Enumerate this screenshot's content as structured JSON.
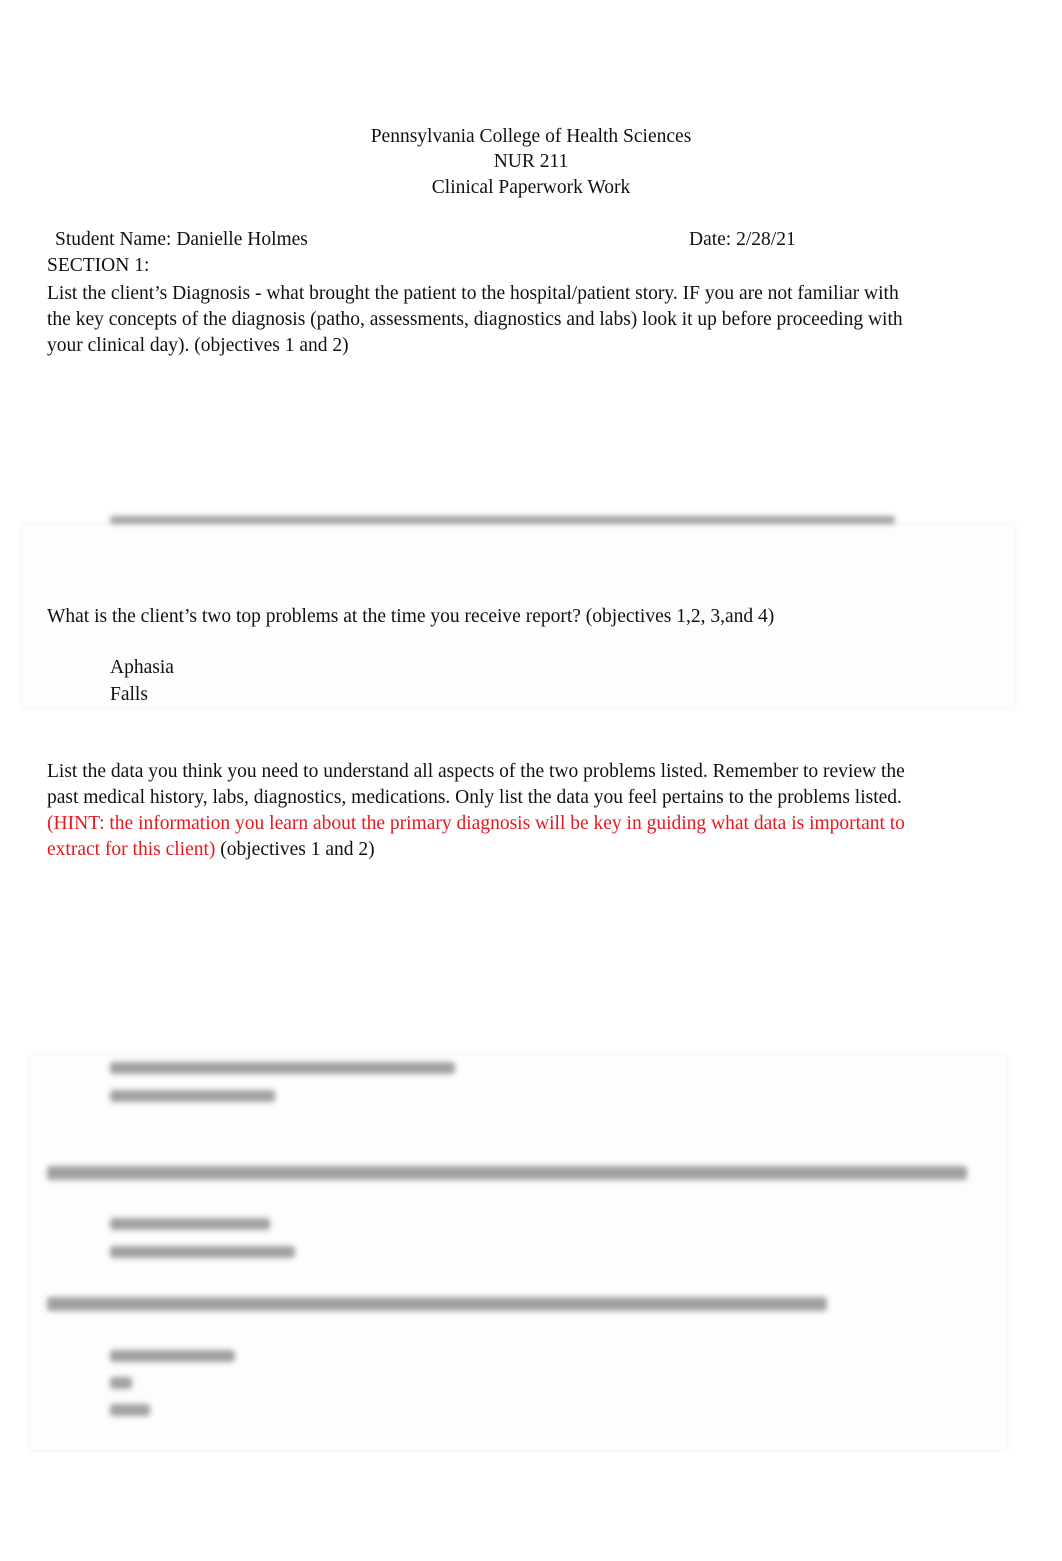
{
  "header": {
    "institution": "Pennsylvania College of Health Sciences",
    "course": "NUR 211",
    "title": "Clinical Paperwork Work"
  },
  "student": {
    "name_label": "Student Name:  Danielle Holmes",
    "date_label": "Date: 2/28/21"
  },
  "section1": {
    "heading": "SECTION 1:",
    "q1_line1": "List the client’s Diagnosis - what brought the patient to the hospital/patient story.   IF you are not familiar with",
    "q1_line2": "the key concepts of the diagnosis (patho, assessments, diagnostics and labs) look it up before proceeding with",
    "q1_line3": "your clinical day).  (objectives 1 and 2)",
    "q2": "What is the client’s two top problems at the time you receive report? (objectives 1,2, 3,and 4)",
    "problems": [
      {
        "bullet": "",
        "text": "Aphasia"
      },
      {
        "bullet": "",
        "text": "Falls"
      }
    ],
    "q3_line1": "List the data you think you need to understand all aspects of the two problems listed.  Remember to review the",
    "q3_line2": "past medical history, labs, diagnostics, medications.  Only list the data you feel pertains to the problems listed.",
    "q3_hint_line1": "(HINT:  the information you learn about the primary diagnosis will be key in guiding what data is important to",
    "q3_hint_line2": "extract for this client)",
    "q3_objectives": " (objectives 1 and 2)"
  },
  "colors": {
    "hint": "#e8181e",
    "text": "#111111"
  }
}
